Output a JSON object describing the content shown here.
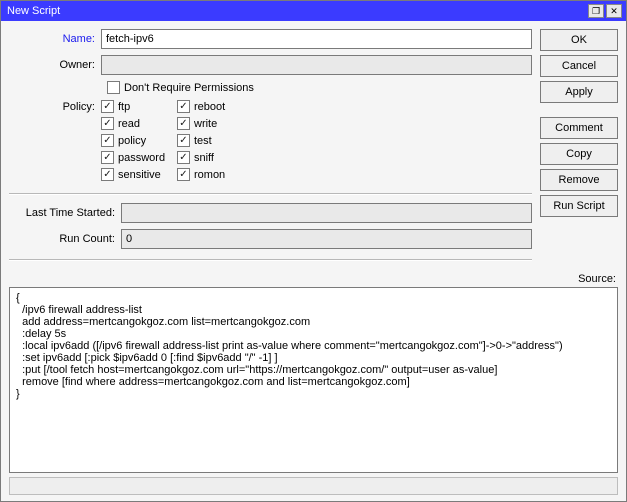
{
  "title": "New Script",
  "labels": {
    "name": "Name:",
    "owner": "Owner:",
    "dont_require_permissions": "Don't Require Permissions",
    "policy": "Policy:",
    "last_time_started": "Last Time Started:",
    "run_count": "Run Count:",
    "source": "Source:"
  },
  "fields": {
    "name": "fetch-ipv6",
    "owner": "",
    "dont_require_permissions": false,
    "last_time_started": "",
    "run_count": "0"
  },
  "policy": [
    {
      "key": "ftp",
      "label": "ftp",
      "checked": true
    },
    {
      "key": "reboot",
      "label": "reboot",
      "checked": true
    },
    {
      "key": "read",
      "label": "read",
      "checked": true
    },
    {
      "key": "write",
      "label": "write",
      "checked": true
    },
    {
      "key": "policy",
      "label": "policy",
      "checked": true
    },
    {
      "key": "test",
      "label": "test",
      "checked": true
    },
    {
      "key": "password",
      "label": "password",
      "checked": true
    },
    {
      "key": "sniff",
      "label": "sniff",
      "checked": true
    },
    {
      "key": "sensitive",
      "label": "sensitive",
      "checked": true
    },
    {
      "key": "romon",
      "label": "romon",
      "checked": true
    }
  ],
  "source": "{\n  /ipv6 firewall address-list\n  add address=mertcangokgoz.com list=mertcangokgoz.com\n  :delay 5s\n  :local ipv6add ([/ipv6 firewall address-list print as-value where comment=\"mertcangokgoz.com\"]->0->\"address\")\n  :set ipv6add [:pick $ipv6add 0 [:find $ipv6add \"/\" -1] ]\n  :put [/tool fetch host=mertcangokgoz.com url=\"https://mertcangokgoz.com/\" output=user as-value]\n  remove [find where address=mertcangokgoz.com and list=mertcangokgoz.com]\n}",
  "buttons": {
    "ok": "OK",
    "cancel": "Cancel",
    "apply": "Apply",
    "comment": "Comment",
    "copy": "Copy",
    "remove": "Remove",
    "run_script": "Run Script"
  }
}
